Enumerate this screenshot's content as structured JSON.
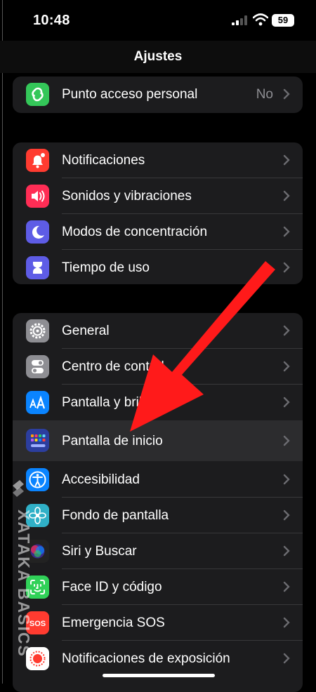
{
  "status": {
    "time": "10:48",
    "battery": "59"
  },
  "nav": {
    "title": "Ajustes"
  },
  "groups": [
    {
      "rows": [
        {
          "label": "Punto acceso personal",
          "value": "No",
          "icon": "hotspot-icon",
          "color": "#34C759"
        }
      ]
    },
    {
      "rows": [
        {
          "label": "Notificaciones",
          "icon": "bell-icon",
          "color": "#FF3B30"
        },
        {
          "label": "Sonidos y vibraciones",
          "icon": "speaker-icon",
          "color": "#FF2D55"
        },
        {
          "label": "Modos de concentración",
          "icon": "moon-icon",
          "color": "#5E5CE6"
        },
        {
          "label": "Tiempo de uso",
          "icon": "hourglass-icon",
          "color": "#5E5CE6"
        }
      ]
    },
    {
      "rows": [
        {
          "label": "General",
          "icon": "gear-icon",
          "color": "#8E8E93"
        },
        {
          "label": "Centro de control",
          "icon": "toggles-icon",
          "color": "#8E8E93"
        },
        {
          "label": "Pantalla y brillo",
          "icon": "text-size-icon",
          "color": "#0A84FF"
        },
        {
          "label": "Pantalla de inicio",
          "icon": "home-grid-icon",
          "color": "#2C3E9E",
          "selected": true
        },
        {
          "label": "Accesibilidad",
          "icon": "accessibility-icon",
          "color": "#0A84FF"
        },
        {
          "label": "Fondo de pantalla",
          "icon": "flower-icon",
          "color": "#30B0C7"
        },
        {
          "label": "Siri y Buscar",
          "icon": "siri-icon",
          "color": "#222222"
        },
        {
          "label": "Face ID y código",
          "icon": "face-id-icon",
          "color": "#30D158"
        },
        {
          "label": "Emergencia SOS",
          "icon": "sos-icon",
          "color": "#FF3B30",
          "icon_text": "SOS"
        },
        {
          "label": "Notificaciones de exposición",
          "icon": "exposure-icon",
          "color": "#FFFFFF"
        }
      ]
    }
  ],
  "watermark": {
    "text": "XATAKA BASICS"
  },
  "annotation": {
    "color": "#FF1A1A"
  }
}
